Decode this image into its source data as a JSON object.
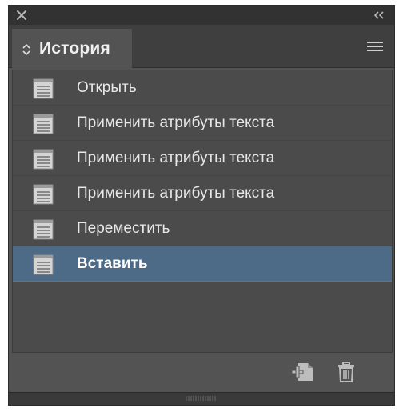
{
  "panel": {
    "tab_title": "История",
    "items": [
      {
        "label": "Открыть",
        "selected": false
      },
      {
        "label": "Применить атрибуты текста",
        "selected": false
      },
      {
        "label": "Применить атрибуты текста",
        "selected": false
      },
      {
        "label": "Применить атрибуты текста",
        "selected": false
      },
      {
        "label": "Переместить",
        "selected": false
      },
      {
        "label": "Вставить",
        "selected": true
      }
    ]
  },
  "icons": {
    "close": "close-icon",
    "collapse": "double-chevron-left-icon",
    "tab_toggle": "up-down-chevron-icon",
    "panel_menu": "hamburger-menu-icon",
    "history_state": "document-page-icon",
    "new_document": "new-document-from-state-icon",
    "delete": "trash-icon"
  },
  "colors": {
    "panel_bg": "#535353",
    "titlebar_bg": "#323232",
    "list_bg": "#4b4b4b",
    "selected_row": "#4d6a86",
    "text": "#e8e8e8"
  }
}
